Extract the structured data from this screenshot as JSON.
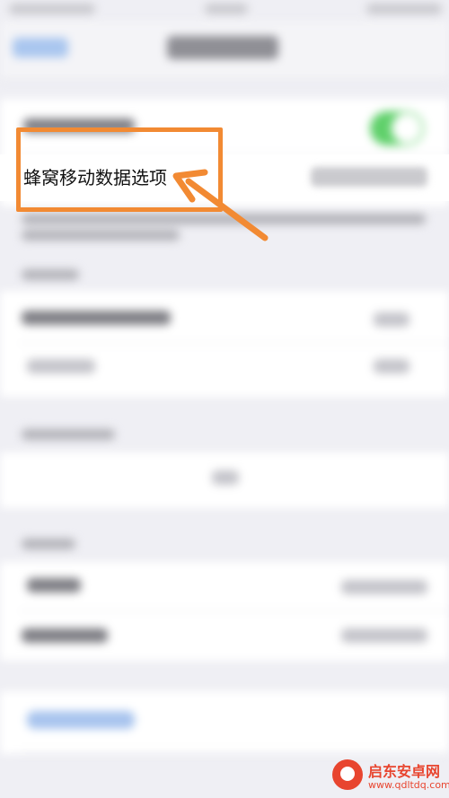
{
  "highlight": {
    "label": "蜂窝移动数据选项"
  },
  "watermark": {
    "brand": "启东安卓网",
    "url": "www.qdltdq.com"
  },
  "colors": {
    "annotation": "#f28a33",
    "toggle_on": "#5fd06a",
    "background": "#efeff4",
    "watermark": "#e8452f"
  }
}
